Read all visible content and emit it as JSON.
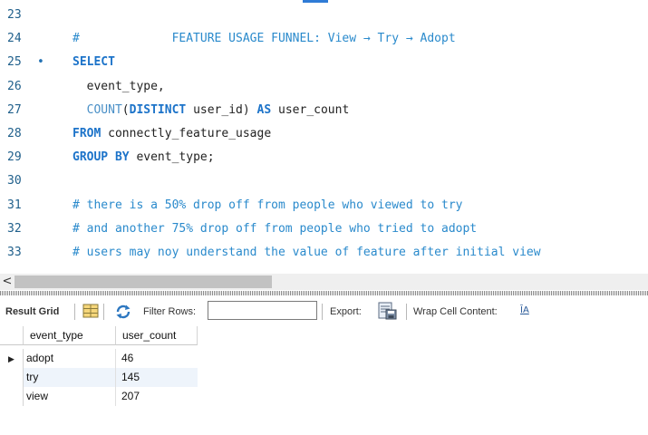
{
  "editor": {
    "lines": [
      {
        "num": "23",
        "parts": []
      },
      {
        "num": "24",
        "parts": [
          {
            "t": "#             FEATURE USAGE FUNNEL: View → Try → Adopt",
            "c": "cm"
          }
        ]
      },
      {
        "num": "25",
        "marker": "•",
        "parts": [
          {
            "t": "SELECT",
            "c": "kw"
          }
        ]
      },
      {
        "num": "26",
        "parts": [
          {
            "t": "  event_type,",
            "c": "plain"
          }
        ]
      },
      {
        "num": "27",
        "parts": [
          {
            "t": "  ",
            "c": "plain"
          },
          {
            "t": "COUNT",
            "c": "fn"
          },
          {
            "t": "(",
            "c": "plain"
          },
          {
            "t": "DISTINCT",
            "c": "kw"
          },
          {
            "t": " user_id) ",
            "c": "plain"
          },
          {
            "t": "AS",
            "c": "kw"
          },
          {
            "t": " user_count",
            "c": "plain"
          }
        ]
      },
      {
        "num": "28",
        "parts": [
          {
            "t": "FROM",
            "c": "kw"
          },
          {
            "t": " connectly_feature_usage",
            "c": "plain"
          }
        ]
      },
      {
        "num": "29",
        "parts": [
          {
            "t": "GROUP BY",
            "c": "kw"
          },
          {
            "t": " event_type;",
            "c": "plain"
          }
        ]
      },
      {
        "num": "30",
        "parts": []
      },
      {
        "num": "31",
        "parts": [
          {
            "t": "# there is a 50% drop off from people who viewed to try",
            "c": "cm"
          }
        ]
      },
      {
        "num": "32",
        "parts": [
          {
            "t": "# and another 75% drop off from people who tried to adopt",
            "c": "cm"
          }
        ]
      },
      {
        "num": "33",
        "parts": [
          {
            "t": "# users may noy understand the value of feature after initial view",
            "c": "cm"
          }
        ]
      }
    ]
  },
  "scrollbar": {
    "left_arrow": "<"
  },
  "toolbar": {
    "result_grid_label": "Result Grid",
    "grid_icon": "grid-view-icon",
    "refresh_icon": "refresh-icon",
    "filter_label": "Filter Rows:",
    "filter_value": "",
    "export_label": "Export:",
    "export_icon": "export-icon",
    "wrap_label": "Wrap Cell Content:",
    "wrap_icon_text": "ĪA"
  },
  "grid": {
    "columns": [
      "event_type",
      "user_count"
    ],
    "rows": [
      {
        "event_type": "adopt",
        "user_count": "46"
      },
      {
        "event_type": "try",
        "user_count": "145"
      },
      {
        "event_type": "view",
        "user_count": "207"
      }
    ],
    "row_pointer": "▶"
  }
}
